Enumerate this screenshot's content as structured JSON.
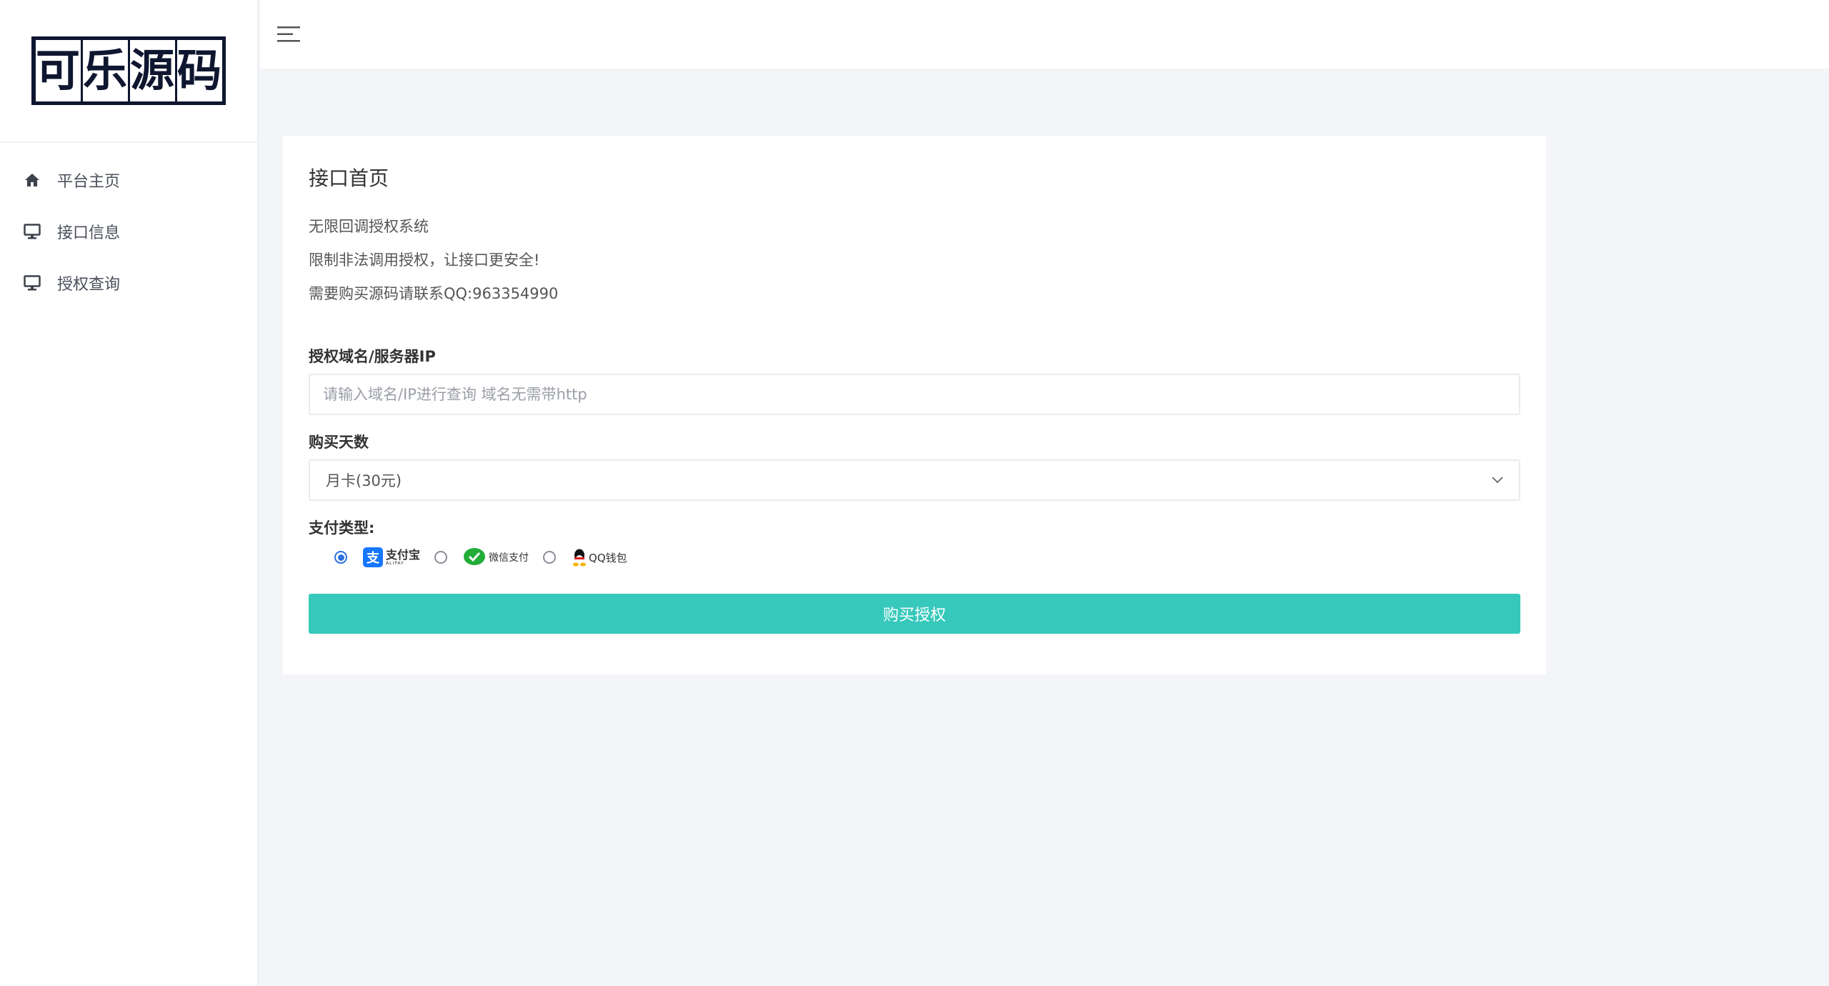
{
  "sidebar": {
    "logo": [
      "可",
      "乐",
      "源",
      "码"
    ],
    "items": [
      {
        "label": "平台主页",
        "icon": "home-icon"
      },
      {
        "label": "接口信息",
        "icon": "monitor-icon"
      },
      {
        "label": "授权查询",
        "icon": "monitor-icon"
      }
    ]
  },
  "card": {
    "title": "接口首页",
    "info": [
      "无限回调授权系统",
      "限制非法调用授权，让接口更安全!",
      "需要购买源码请联系QQ:963354990"
    ]
  },
  "form": {
    "domain_label": "授权域名/服务器IP",
    "domain_placeholder": "请输入域名/IP进行查询 域名无需带http",
    "days_label": "购买天数",
    "days_selected": "月卡(30元)",
    "pay_label": "支付类型:",
    "pay_options": [
      {
        "label": "支付宝",
        "sub": "ALIPAY",
        "icon": "alipay-icon",
        "checked": true
      },
      {
        "label": "微信支付",
        "icon": "wechat-pay-icon",
        "checked": false
      },
      {
        "label": "QQ钱包",
        "icon": "qq-wallet-icon",
        "checked": false
      }
    ],
    "submit_label": "购买授权"
  },
  "colors": {
    "accent": "#36c9bb",
    "background": "#f4f5f8",
    "logo_bg": "#0f1630"
  }
}
